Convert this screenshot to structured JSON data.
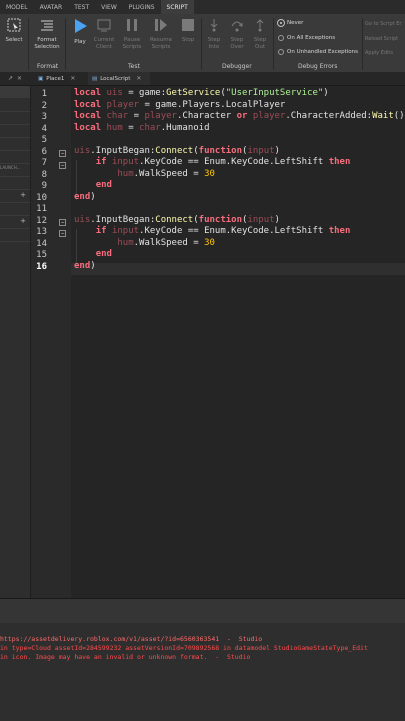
{
  "menubar": {
    "items": [
      "MODEL",
      "AVATAR",
      "TEST",
      "VIEW",
      "PLUGINS",
      "SCRIPT"
    ],
    "active": "SCRIPT"
  },
  "ribbon": {
    "select": "Select",
    "format_selection": "Format Selection",
    "play": "Play",
    "current_client": "Current Client",
    "pause_scripts": "Pause Scripts",
    "resume_scripts": "Resume Scripts",
    "stop": "Stop",
    "step_into": "Step Into",
    "step_over": "Step Over",
    "step_out": "Step Out",
    "group_format": "Format",
    "group_test": "Test",
    "group_debugger": "Debugger",
    "group_debug_errors": "Debug Errors",
    "debug_errors_options": [
      "Never",
      "On All Exceptions",
      "On Unhandled Exceptions"
    ],
    "debug_errors_selected": "Never",
    "right_items": [
      "Go to Script Er",
      "Reload Script",
      "Apply Edits"
    ]
  },
  "tabs": [
    {
      "label": "Place1"
    },
    {
      "label": "LocalScript"
    }
  ],
  "editor": {
    "line_numbers": [
      "1",
      "2",
      "3",
      "4",
      "5",
      "6",
      "7",
      "8",
      "9",
      "10",
      "11",
      "12",
      "13",
      "14",
      "15",
      "16"
    ],
    "current_line": "16"
  },
  "left_panel_text": "LAUNCH...",
  "output": {
    "lines": [
      {
        "text": "https://assetdelivery.roblox.com/v1/asset/?id=6560363541  -  Studio",
        "color": "#ff6a6a"
      },
      {
        "text": "in type=Cloud assetId=284599232 assetVersionId=709892568 in datamodel StudioGameStateType_Edit",
        "color": "#ff4b4b"
      },
      {
        "text": "in icon. Image may have an invalid or unknown format.  -  Studio",
        "color": "#ff4b4b"
      }
    ]
  },
  "colors": {
    "keyword": "#f86d7c",
    "function": "#fdfbac",
    "string": "#adf195",
    "number": "#ffc600",
    "property": "#61a1f1",
    "accent": "#5fa8e8"
  }
}
